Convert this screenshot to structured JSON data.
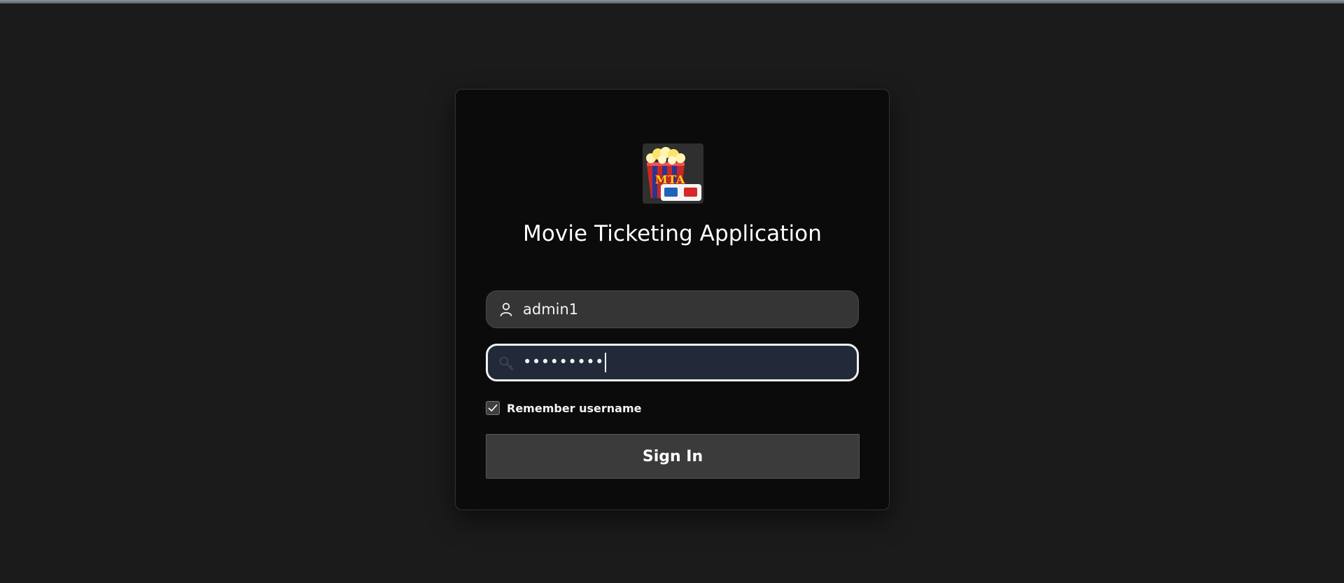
{
  "app": {
    "title": "Movie Ticketing Application",
    "logo_text": "MTA",
    "logo_icon": "popcorn-3d-glasses-icon"
  },
  "form": {
    "username": {
      "value": "admin1",
      "icon": "user-icon"
    },
    "password": {
      "masked_value": "•••••••••",
      "icon": "key-icon",
      "focused": true
    },
    "remember": {
      "label": "Remember username",
      "checked": true
    },
    "submit_label": "Sign In"
  },
  "colors": {
    "background": "#1b1b1b",
    "card": "#0b0b0b",
    "input_bg": "#353535",
    "focused_input_bg": "#222a3a",
    "button_bg": "#3b3b3b"
  }
}
